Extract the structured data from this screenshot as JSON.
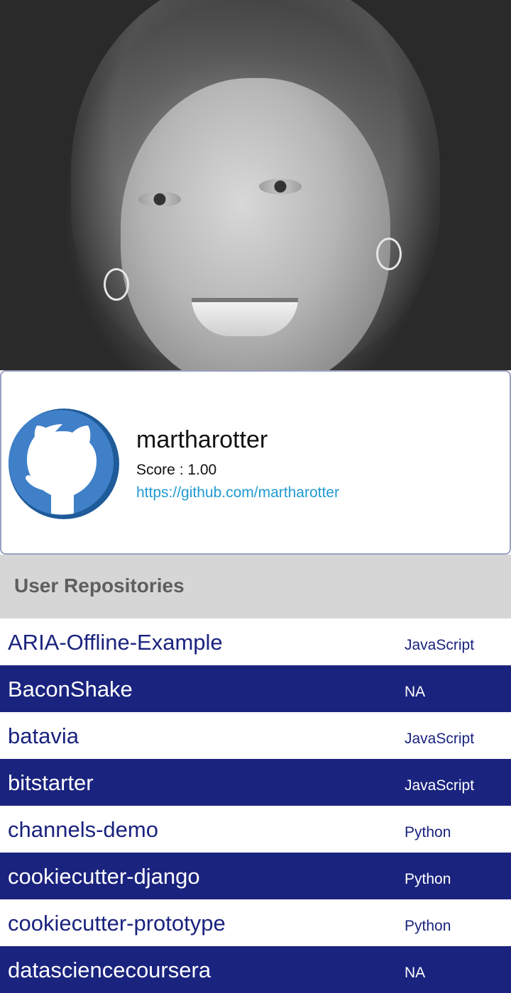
{
  "profile": {
    "username": "martharotter",
    "score": "Score : 1.00",
    "url": "https://github.com/martharotter"
  },
  "section": {
    "title": "User Repositories"
  },
  "repos": [
    {
      "name": "ARIA-Offline-Example",
      "language": "JavaScript"
    },
    {
      "name": "BaconShake",
      "language": "NA"
    },
    {
      "name": "batavia",
      "language": "JavaScript"
    },
    {
      "name": "bitstarter",
      "language": "JavaScript"
    },
    {
      "name": "channels-demo",
      "language": "Python"
    },
    {
      "name": "cookiecutter-django",
      "language": "Python"
    },
    {
      "name": "cookiecutter-prototype",
      "language": "Python"
    },
    {
      "name": "datasciencecoursera",
      "language": "NA"
    }
  ],
  "colors": {
    "accent": "#1a237e",
    "link": "#1f9ad1",
    "header_bg": "#d6d6d6",
    "avatar_blue": "#3f7fc4"
  },
  "icons": {
    "avatar": "github-octocat-icon"
  }
}
